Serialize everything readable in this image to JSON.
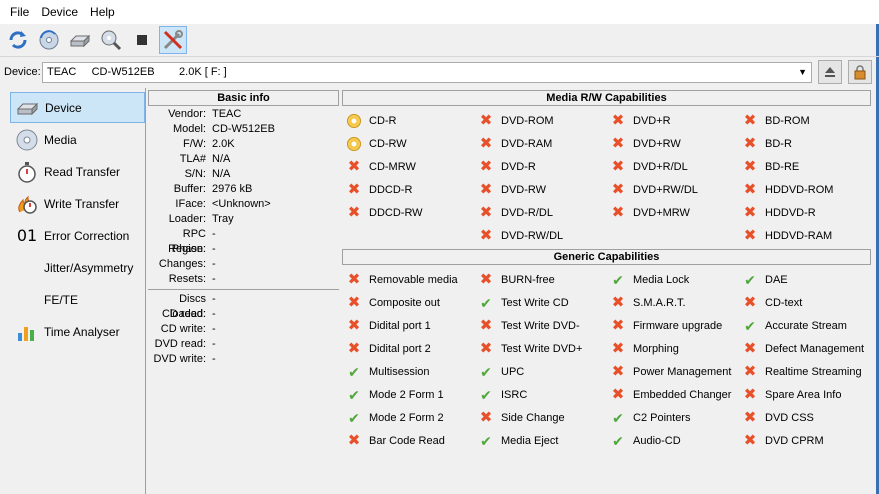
{
  "menu": [
    "File",
    "Device",
    "Help"
  ],
  "toolbar": {
    "icons": [
      "refresh-icon",
      "disc-refresh-icon",
      "drive-icon",
      "disc-scan-icon",
      "stop-icon",
      "tools-icon"
    ]
  },
  "device": {
    "label": "Device:",
    "value": "TEAC     CD-W512EB        2.0K [ F: ]"
  },
  "sidebar": {
    "items": [
      {
        "label": "Device",
        "icon": "drive-icon",
        "active": true
      },
      {
        "label": "Media",
        "icon": "disc-icon"
      },
      {
        "label": "Read Transfer",
        "icon": "stopwatch-icon"
      },
      {
        "label": "Write Transfer",
        "icon": "stopwatch-flame-icon"
      },
      {
        "label": "Error Correction",
        "icon": "binary-icon",
        "glyph": "01"
      },
      {
        "label": "Jitter/Asymmetry",
        "icon": ""
      },
      {
        "label": "FE/TE",
        "icon": ""
      },
      {
        "label": "Time Analyser",
        "icon": "bar-chart-icon"
      }
    ]
  },
  "basic_info": {
    "title": "Basic info",
    "rows": [
      {
        "k": "Vendor:",
        "v": "TEAC"
      },
      {
        "k": "Model:",
        "v": "CD-W512EB"
      },
      {
        "k": "F/W:",
        "v": "2.0K"
      },
      {
        "k": "TLA#",
        "v": "N/A"
      },
      {
        "k": "S/N:",
        "v": "N/A"
      },
      {
        "k": "Buffer:",
        "v": "2976 kB"
      },
      {
        "k": "IFace:",
        "v": "<Unknown>"
      },
      {
        "k": "Loader:",
        "v": "Tray"
      },
      {
        "k": "RPC Phase:",
        "v": "-"
      },
      {
        "k": "Region:",
        "v": "-"
      },
      {
        "k": "Changes:",
        "v": "-"
      },
      {
        "k": "Resets:",
        "v": "-"
      }
    ],
    "rows2": [
      {
        "k": "Discs loaded:",
        "v": "-"
      },
      {
        "k": "CD read:",
        "v": "-"
      },
      {
        "k": "CD write:",
        "v": "-"
      },
      {
        "k": "DVD read:",
        "v": "-"
      },
      {
        "k": "DVD write:",
        "v": "-"
      }
    ]
  },
  "media_rw": {
    "title": "Media R/W Capabilities",
    "items": [
      {
        "label": "CD-R",
        "status": "partial"
      },
      {
        "label": "DVD-ROM",
        "status": "no"
      },
      {
        "label": "DVD+R",
        "status": "no"
      },
      {
        "label": "BD-ROM",
        "status": "no"
      },
      {
        "label": "CD-RW",
        "status": "partial"
      },
      {
        "label": "DVD-RAM",
        "status": "no"
      },
      {
        "label": "DVD+RW",
        "status": "no"
      },
      {
        "label": "BD-R",
        "status": "no"
      },
      {
        "label": "CD-MRW",
        "status": "no"
      },
      {
        "label": "DVD-R",
        "status": "no"
      },
      {
        "label": "DVD+R/DL",
        "status": "no"
      },
      {
        "label": "BD-RE",
        "status": "no"
      },
      {
        "label": "DDCD-R",
        "status": "no"
      },
      {
        "label": "DVD-RW",
        "status": "no"
      },
      {
        "label": "DVD+RW/DL",
        "status": "no"
      },
      {
        "label": "HDDVD-ROM",
        "status": "no"
      },
      {
        "label": "DDCD-RW",
        "status": "no"
      },
      {
        "label": "DVD-R/DL",
        "status": "no"
      },
      {
        "label": "DVD+MRW",
        "status": "no"
      },
      {
        "label": "HDDVD-R",
        "status": "no"
      },
      {
        "label": "",
        "status": "none"
      },
      {
        "label": "DVD-RW/DL",
        "status": "no"
      },
      {
        "label": "",
        "status": "none"
      },
      {
        "label": "HDDVD-RAM",
        "status": "no"
      }
    ]
  },
  "generic": {
    "title": "Generic Capabilities",
    "items": [
      {
        "label": "Removable media",
        "status": "no"
      },
      {
        "label": "BURN-free",
        "status": "no"
      },
      {
        "label": "Media Lock",
        "status": "yes"
      },
      {
        "label": "DAE",
        "status": "yes"
      },
      {
        "label": "Composite out",
        "status": "no"
      },
      {
        "label": "Test Write CD",
        "status": "yes"
      },
      {
        "label": "S.M.A.R.T.",
        "status": "no"
      },
      {
        "label": "CD-text",
        "status": "no"
      },
      {
        "label": "Didital port 1",
        "status": "no"
      },
      {
        "label": "Test Write DVD-",
        "status": "no"
      },
      {
        "label": "Firmware upgrade",
        "status": "no"
      },
      {
        "label": "Accurate Stream",
        "status": "yes"
      },
      {
        "label": "Didital port 2",
        "status": "no"
      },
      {
        "label": "Test Write DVD+",
        "status": "no"
      },
      {
        "label": "Morphing",
        "status": "no"
      },
      {
        "label": "Defect Management",
        "status": "no"
      },
      {
        "label": "Multisession",
        "status": "yes"
      },
      {
        "label": "UPC",
        "status": "yes"
      },
      {
        "label": "Power Management",
        "status": "no"
      },
      {
        "label": "Realtime Streaming",
        "status": "no"
      },
      {
        "label": "Mode 2 Form 1",
        "status": "yes"
      },
      {
        "label": "ISRC",
        "status": "yes"
      },
      {
        "label": "Embedded Changer",
        "status": "no"
      },
      {
        "label": "Spare Area Info",
        "status": "no"
      },
      {
        "label": "Mode 2 Form 2",
        "status": "yes"
      },
      {
        "label": "Side Change",
        "status": "no"
      },
      {
        "label": "C2 Pointers",
        "status": "yes"
      },
      {
        "label": "DVD CSS",
        "status": "no"
      },
      {
        "label": "Bar Code Read",
        "status": "no"
      },
      {
        "label": "Media Eject",
        "status": "yes"
      },
      {
        "label": "Audio-CD",
        "status": "yes"
      },
      {
        "label": "DVD CPRM",
        "status": "no"
      }
    ]
  },
  "colors": {
    "accent": "#cde6f7",
    "no": "#e8502a",
    "yes": "#4ea83a",
    "partial": "#f5c23a"
  }
}
